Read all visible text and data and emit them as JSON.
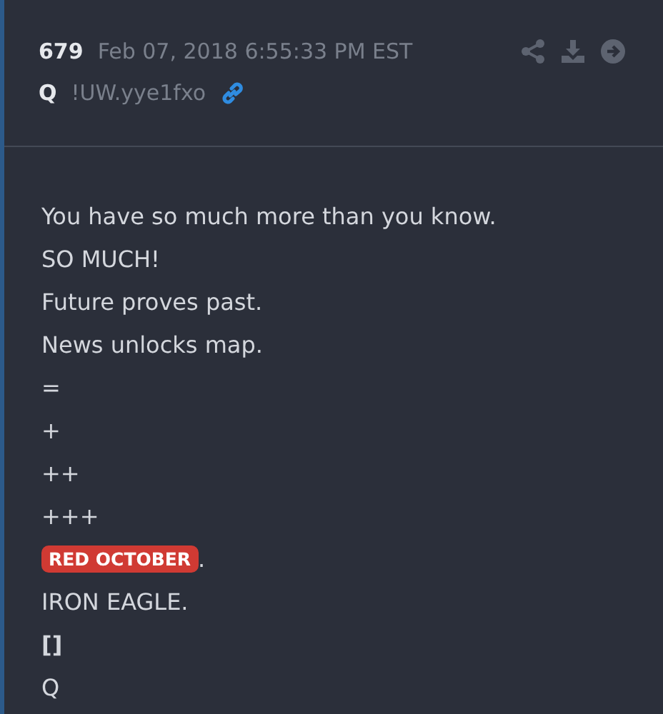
{
  "post": {
    "number": "679",
    "timestamp": "Feb 07, 2018 6:55:33 PM EST",
    "author": "Q",
    "tripcode": "!UW.yye1fxo"
  },
  "lines": [
    {
      "kind": "text",
      "text": "You have so much more than you know."
    },
    {
      "kind": "text",
      "text": "SO MUCH!"
    },
    {
      "kind": "text",
      "text": "Future proves past."
    },
    {
      "kind": "text",
      "text": "News unlocks map."
    },
    {
      "kind": "text",
      "text": "="
    },
    {
      "kind": "text",
      "text": "+"
    },
    {
      "kind": "text",
      "text": "++"
    },
    {
      "kind": "text",
      "text": "+++"
    },
    {
      "kind": "tag",
      "tag": "RED OCTOBER",
      "text": "."
    },
    {
      "kind": "text",
      "text": "IRON EAGLE."
    },
    {
      "kind": "bold",
      "text": "[]"
    },
    {
      "kind": "text",
      "text": "Q"
    }
  ]
}
